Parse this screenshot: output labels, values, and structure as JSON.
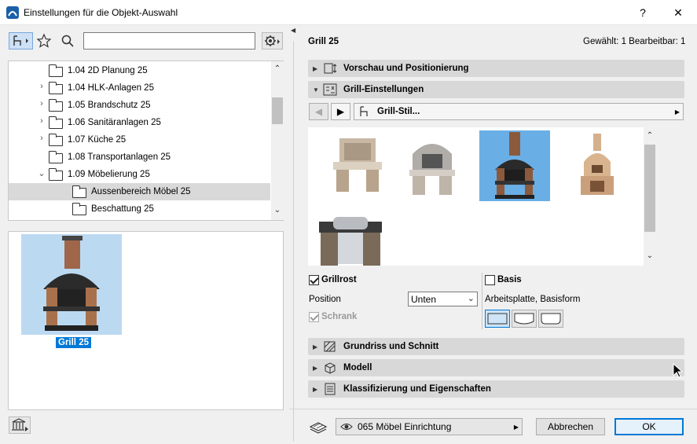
{
  "window": {
    "title": "Einstellungen für die Objekt-Auswahl",
    "help_label": "?",
    "close_label": "✕"
  },
  "left": {
    "search_value": "",
    "search_placeholder": "",
    "tree": [
      {
        "label": "1.04 2D Planung 25",
        "expander": "",
        "level": 0,
        "selected": false
      },
      {
        "label": "1.04 HLK-Anlagen 25",
        "expander": "›",
        "level": 0,
        "selected": false
      },
      {
        "label": "1.05 Brandschutz 25",
        "expander": "›",
        "level": 0,
        "selected": false
      },
      {
        "label": "1.06 Sanitäranlagen 25",
        "expander": "›",
        "level": 0,
        "selected": false
      },
      {
        "label": "1.07 Küche 25",
        "expander": "›",
        "level": 0,
        "selected": false
      },
      {
        "label": "1.08 Transportanlagen 25",
        "expander": "",
        "level": 0,
        "selected": false
      },
      {
        "label": "1.09 Möbelierung 25",
        "expander": "⌄",
        "level": 0,
        "selected": false
      },
      {
        "label": "Aussenbereich Möbel 25",
        "expander": "",
        "level": 1,
        "selected": true
      },
      {
        "label": "Beschattung 25",
        "expander": "",
        "level": 1,
        "selected": false
      }
    ],
    "preview_label": "Grill 25"
  },
  "right": {
    "object_name": "Grill 25",
    "selection_info": "Gewählt: 1 Bearbeitbar: 1",
    "sections": {
      "preview": "Vorschau und Positionierung",
      "grill": "Grill-Einstellungen",
      "plan": "Grundriss und Schnitt",
      "model": "Modell",
      "classification": "Klassifizierung und Eigenschaften"
    },
    "style_label": "Grill-Stil...",
    "grillrost_label": "Grillrost",
    "position_label": "Position",
    "position_value": "Unten",
    "schrank_label": "Schrank",
    "basis_label": "Basis",
    "basisform_label": "Arbeitsplatte, Basisform"
  },
  "footer": {
    "layer_value": "065 Möbel Einrichtung",
    "cancel_label": "Abbrechen",
    "ok_label": "OK"
  },
  "colors": {
    "selection_blue": "#0078d7",
    "thumb_selected_bg": "#6aaee6",
    "preview_bg": "#bcd9f2"
  }
}
